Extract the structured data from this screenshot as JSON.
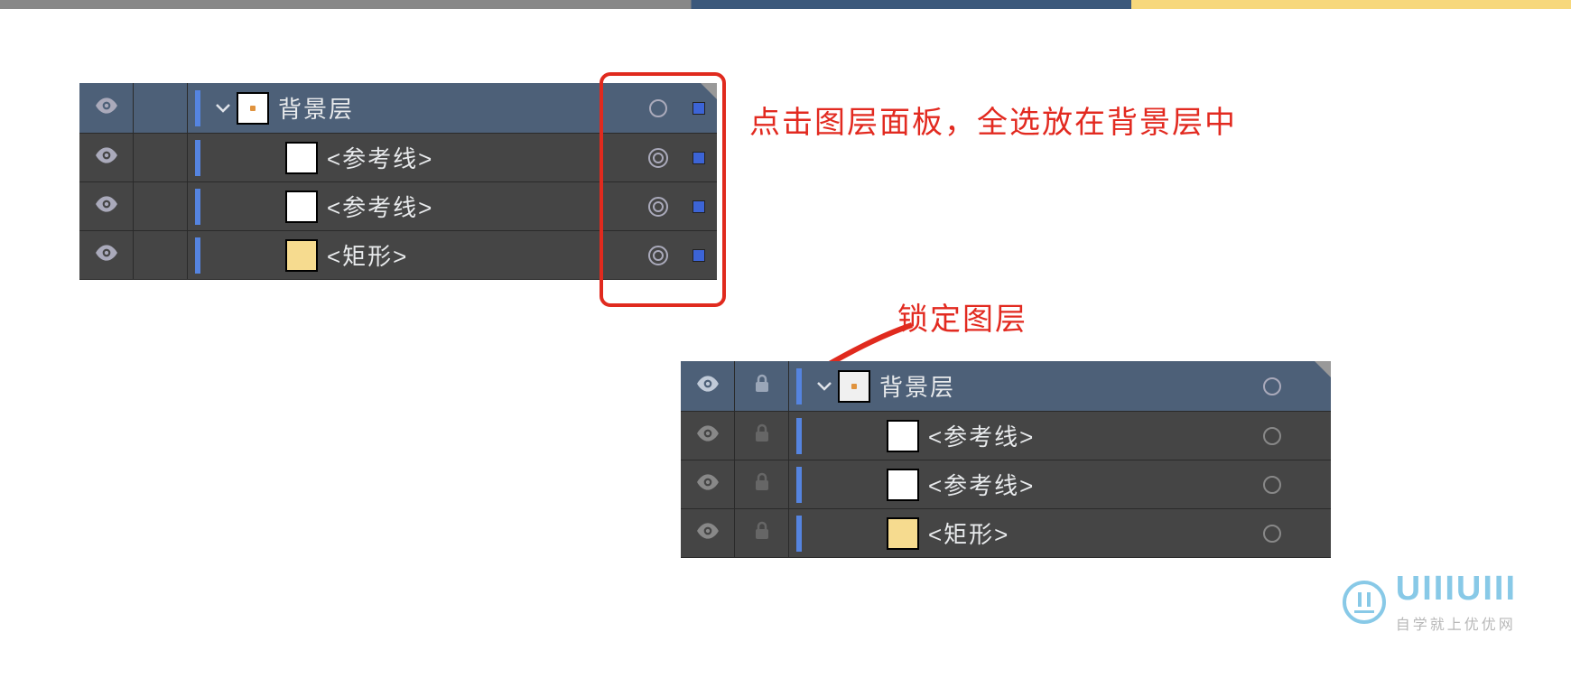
{
  "annotations": {
    "select_all": "点击图层面板，全选放在背景层中",
    "lock_layer": "锁定图层"
  },
  "panel1": {
    "header": {
      "label": "背景层"
    },
    "rows": [
      {
        "label": "<参考线>",
        "swatch": "white"
      },
      {
        "label": "<参考线>",
        "swatch": "white"
      },
      {
        "label": "<矩形>",
        "swatch": "yellow"
      }
    ]
  },
  "panel2": {
    "header": {
      "label": "背景层"
    },
    "rows": [
      {
        "label": "<参考线>",
        "swatch": "white"
      },
      {
        "label": "<参考线>",
        "swatch": "white"
      },
      {
        "label": "<矩形>",
        "swatch": "yellow"
      }
    ]
  },
  "watermark": {
    "brand": "UIIIUIII",
    "tagline": "自学就上优优网"
  }
}
